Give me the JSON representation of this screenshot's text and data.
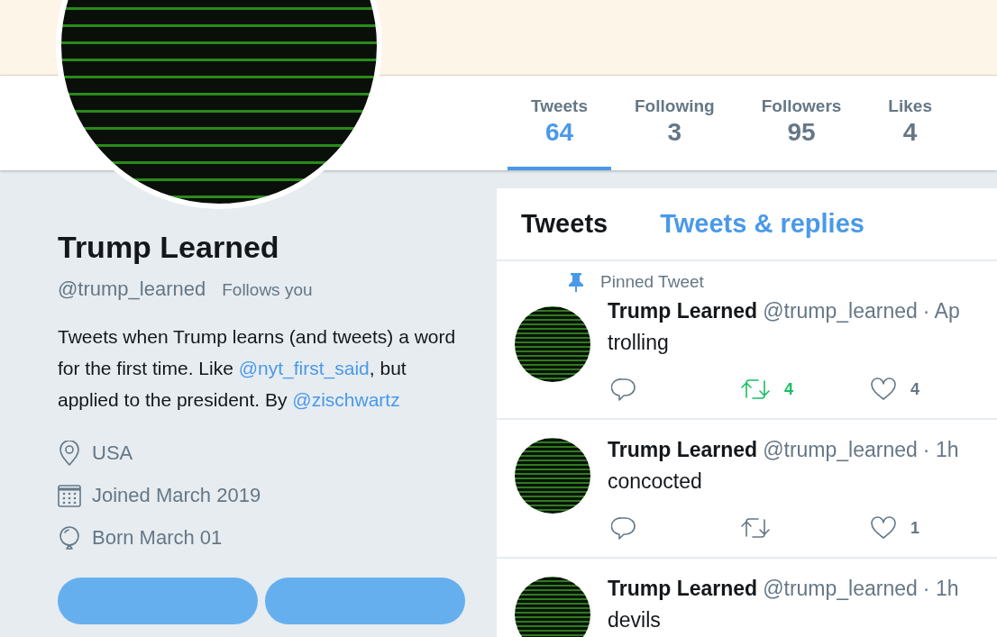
{
  "stats": [
    {
      "label": "Tweets",
      "value": "64",
      "selected": true
    },
    {
      "label": "Following",
      "value": "3",
      "selected": false
    },
    {
      "label": "Followers",
      "value": "95",
      "selected": false
    },
    {
      "label": "Likes",
      "value": "4",
      "selected": false
    }
  ],
  "profile": {
    "name": "Trump Learned",
    "handle": "@trump_learned",
    "follows_you": "Follows you",
    "bio": [
      {
        "kind": "text",
        "text": "Tweets when Trump learns (and tweets) a word for the first time. Like "
      },
      {
        "kind": "link",
        "text": "@nyt_first_said"
      },
      {
        "kind": "text",
        "text": ", but applied to the president. By "
      },
      {
        "kind": "link",
        "text": "@zischwartz"
      }
    ],
    "details": [
      {
        "kind": "location",
        "text": "USA"
      },
      {
        "kind": "joined",
        "text": "Joined March 2019"
      },
      {
        "kind": "birthday",
        "text": "Born March 01"
      }
    ]
  },
  "timeline_tabs": [
    {
      "label": "Tweets",
      "selected": true
    },
    {
      "label": "Tweets & replies",
      "selected": false
    }
  ],
  "tweets": [
    {
      "pinned_label": "Pinned Tweet",
      "name": "Trump Learned",
      "handle": "@trump_learned",
      "time": "· Ap",
      "text": "trolling",
      "actions": {
        "retweeted": true,
        "retweets": "4",
        "likes": "4"
      }
    },
    {
      "name": "Trump Learned",
      "handle": "@trump_learned",
      "time": "· 1h",
      "text": "concocted",
      "actions": {
        "retweeted": false,
        "likes": "1"
      }
    },
    {
      "name": "Trump Learned",
      "handle": "@trump_learned",
      "time": "· 1h",
      "text": "devils"
    }
  ]
}
